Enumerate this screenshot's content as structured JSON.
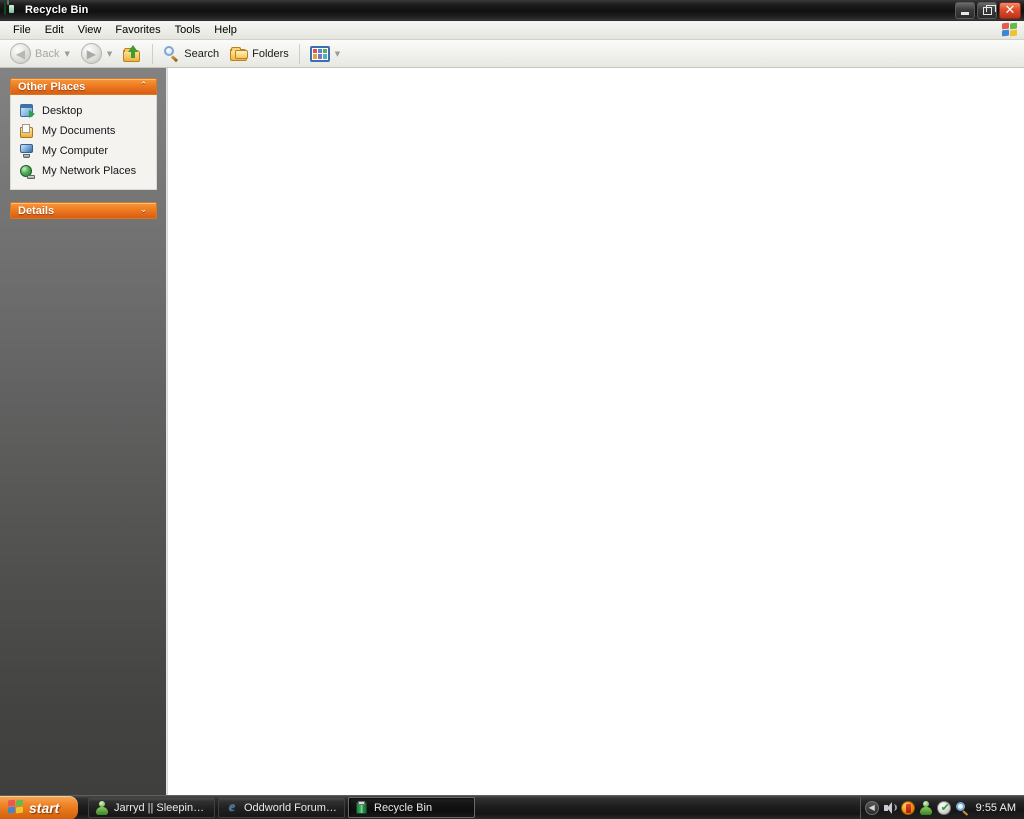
{
  "window": {
    "title": "Recycle Bin",
    "title_icon": "recycle-bin-icon",
    "controls": {
      "minimize": "Minimize",
      "restore": "Restore",
      "close": "Close"
    }
  },
  "menu": {
    "items": [
      {
        "label": "File"
      },
      {
        "label": "Edit"
      },
      {
        "label": "View"
      },
      {
        "label": "Favorites"
      },
      {
        "label": "Tools"
      },
      {
        "label": "Help"
      }
    ],
    "brand_icon": "windows-flag-icon"
  },
  "toolbar": {
    "back_label": "Back",
    "back_icon": "arrow-left-icon",
    "back_enabled": false,
    "forward_icon": "arrow-right-icon",
    "forward_enabled": false,
    "up_icon": "folder-up-icon",
    "search_label": "Search",
    "search_icon": "magnifier-icon",
    "folders_label": "Folders",
    "folders_icon": "folder-icon",
    "views_icon": "views-grid-icon",
    "views_caret_icon": "chevron-down-icon"
  },
  "sidebar": {
    "panels": [
      {
        "title": "Other Places",
        "collapse_icon": "chevron-up-icon",
        "collapsed": false,
        "items": [
          {
            "label": "Desktop",
            "icon": "desktop-icon"
          },
          {
            "label": "My Documents",
            "icon": "documents-icon"
          },
          {
            "label": "My Computer",
            "icon": "computer-icon"
          },
          {
            "label": "My Network Places",
            "icon": "network-icon"
          }
        ]
      },
      {
        "title": "Details",
        "collapse_icon": "chevron-down-icon",
        "collapsed": true,
        "items": []
      }
    ]
  },
  "content": {
    "items": [],
    "empty": true
  },
  "taskbar": {
    "start_label": "start",
    "start_icon": "windows-flag-icon",
    "tasks": [
      {
        "label": "Jarryd || Sleeping *s...",
        "icon": "messenger-contact-icon",
        "active": false
      },
      {
        "label": "Oddworld Forums - E...",
        "icon": "internet-explorer-icon",
        "active": false
      },
      {
        "label": "Recycle Bin",
        "icon": "recycle-bin-icon",
        "active": true
      }
    ],
    "tray": {
      "expand_icon": "chevron-left-icon",
      "icons": [
        {
          "name": "volume-icon"
        },
        {
          "name": "security-alert-icon"
        },
        {
          "name": "messenger-icon"
        },
        {
          "name": "update-check-icon"
        },
        {
          "name": "search-assistant-icon"
        }
      ],
      "clock": "9:55 AM"
    }
  },
  "colors": {
    "accent_orange": "#ef7f22",
    "titlebar_dark": "#141414",
    "sidebar_top": "#828282",
    "sidebar_bottom": "#3f3f3e",
    "content_bg": "#ffffff",
    "close_red": "#e0502c"
  }
}
